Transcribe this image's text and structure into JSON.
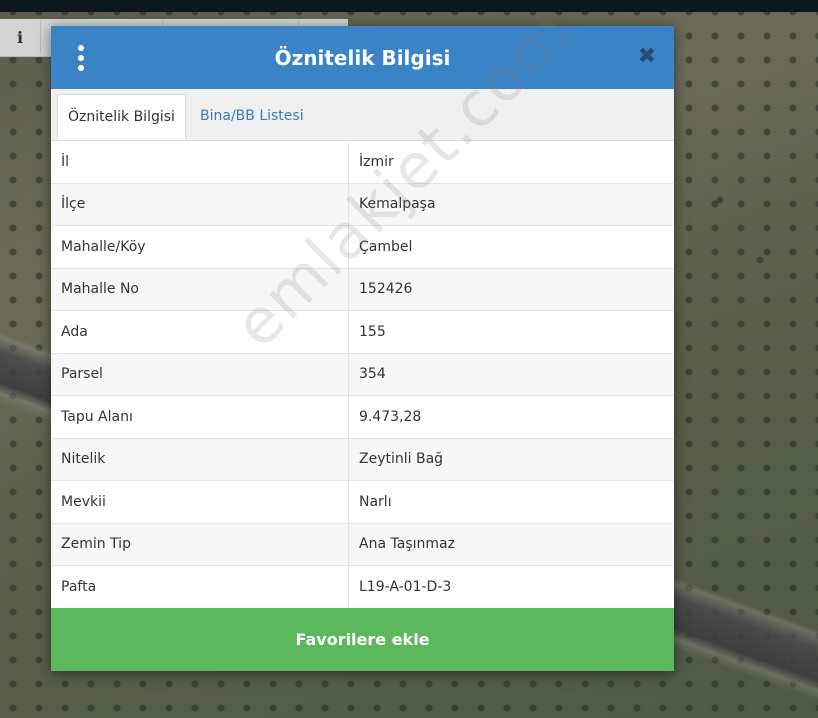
{
  "map": {
    "info_icon": "i"
  },
  "dialog": {
    "title": "Öznitelik Bilgisi",
    "menu_icon": "kebab-menu-icon",
    "close_icon": "close-icon",
    "close_glyph": "✖"
  },
  "tabs": [
    {
      "label": "Öznitelik Bilgisi",
      "active": true
    },
    {
      "label": "Bina/BB Listesi",
      "active": false
    }
  ],
  "attributes": [
    {
      "key": "İl",
      "value": "İzmir"
    },
    {
      "key": "İlçe",
      "value": "Kemalpaşa"
    },
    {
      "key": "Mahalle/Köy",
      "value": "Çambel"
    },
    {
      "key": "Mahalle No",
      "value": "152426"
    },
    {
      "key": "Ada",
      "value": "155"
    },
    {
      "key": "Parsel",
      "value": "354"
    },
    {
      "key": "Tapu Alanı",
      "value": "9.473,28"
    },
    {
      "key": "Nitelik",
      "value": "Zeytinli Bağ"
    },
    {
      "key": "Mevkii",
      "value": "Narlı"
    },
    {
      "key": "Zemin Tip",
      "value": "Ana Taşınmaz"
    },
    {
      "key": "Pafta",
      "value": "L19-A-01-D-3"
    }
  ],
  "favorite_button": "Favorilere ekle",
  "watermark": "emlakjet.com",
  "colors": {
    "header": "#3a83c5",
    "button": "#5cb85c",
    "tab_link": "#3a7ab8"
  }
}
